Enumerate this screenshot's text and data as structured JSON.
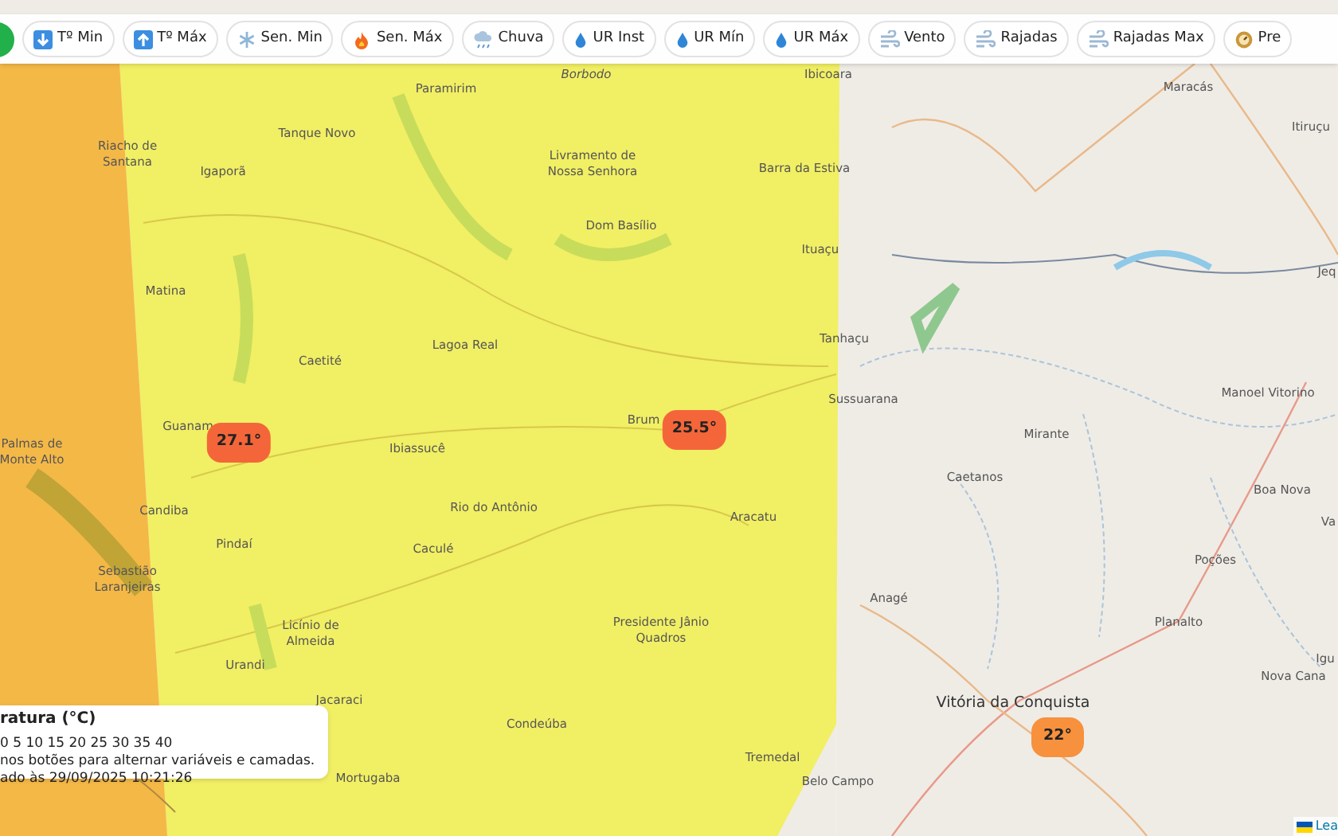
{
  "toolbar": {
    "buttons": [
      {
        "label": "Tº Min",
        "selected": false
      },
      {
        "label": "Tº Máx",
        "selected": false
      },
      {
        "label": "Sen. Min",
        "selected": false
      },
      {
        "label": "Sen. Máx",
        "selected": false
      },
      {
        "label": "Chuva",
        "selected": false
      },
      {
        "label": "UR Inst",
        "selected": false
      },
      {
        "label": "UR Mín",
        "selected": false
      },
      {
        "label": "UR Máx",
        "selected": false
      },
      {
        "label": "Vento",
        "selected": false
      },
      {
        "label": "Rajadas",
        "selected": false
      },
      {
        "label": "Rajadas Max",
        "selected": false
      },
      {
        "label": "Pre",
        "selected": false
      }
    ]
  },
  "map": {
    "places": [
      {
        "name": "Borbodo"
      },
      {
        "name": "Paramirim"
      },
      {
        "name": "Tanque Novo"
      },
      {
        "name": "Riacho de Santana"
      },
      {
        "name": "Igaporã"
      },
      {
        "name": "Matina"
      },
      {
        "name": "Caetité"
      },
      {
        "name": "Lagoa Real"
      },
      {
        "name": "Livramento de Nossa Senhora"
      },
      {
        "name": "Dom Basílio"
      },
      {
        "name": "Ibicoara"
      },
      {
        "name": "Barra da Estiva"
      },
      {
        "name": "Ituaçu"
      },
      {
        "name": "Tanhaçu"
      },
      {
        "name": "Maracás"
      },
      {
        "name": "Itiruçu"
      },
      {
        "name": "Jeq"
      },
      {
        "name": "Sussuarana"
      },
      {
        "name": "Manoel Vitorino"
      },
      {
        "name": "Mirante"
      },
      {
        "name": "Caetanos"
      },
      {
        "name": "Boa Nova"
      },
      {
        "name": "Va"
      },
      {
        "name": "Poções"
      },
      {
        "name": "Planalto"
      },
      {
        "name": "Igu"
      },
      {
        "name": "Nova Cana"
      },
      {
        "name": "Anagé"
      },
      {
        "name": "Vitória da Conquista"
      },
      {
        "name": "Belo Campo"
      },
      {
        "name": "Aracatu"
      },
      {
        "name": "Tremedal"
      },
      {
        "name": "Licínio de Almeida"
      },
      {
        "name": "Presidente Jânio Quadros"
      },
      {
        "name": "Urandi"
      },
      {
        "name": "Caculé"
      },
      {
        "name": "Rio do Antônio"
      },
      {
        "name": "Ibiassucê"
      },
      {
        "name": "Guanam"
      },
      {
        "name": "Candiba"
      },
      {
        "name": "Pindaí"
      },
      {
        "name": "Palmas de Monte Alto"
      },
      {
        "name": "Sebastião Laranjeiras"
      },
      {
        "name": "Brum"
      },
      {
        "name": "Jacaraci"
      },
      {
        "name": "Mortugaba"
      },
      {
        "name": "Condeúba"
      }
    ],
    "markers": [
      {
        "value": "27.1°",
        "color": "#f4663a"
      },
      {
        "value": "25.5°",
        "color": "#f4663a"
      },
      {
        "value": "22°",
        "color": "#f7913d"
      }
    ],
    "attribution": "Lea"
  },
  "legend": {
    "title": "ratura (°C)",
    "scale": "0 5 10 15 20 25 30 35 40",
    "hint": "nos botões para alternar variáveis e camadas.",
    "updated": "ado às 29/09/2025 10:21:26"
  }
}
